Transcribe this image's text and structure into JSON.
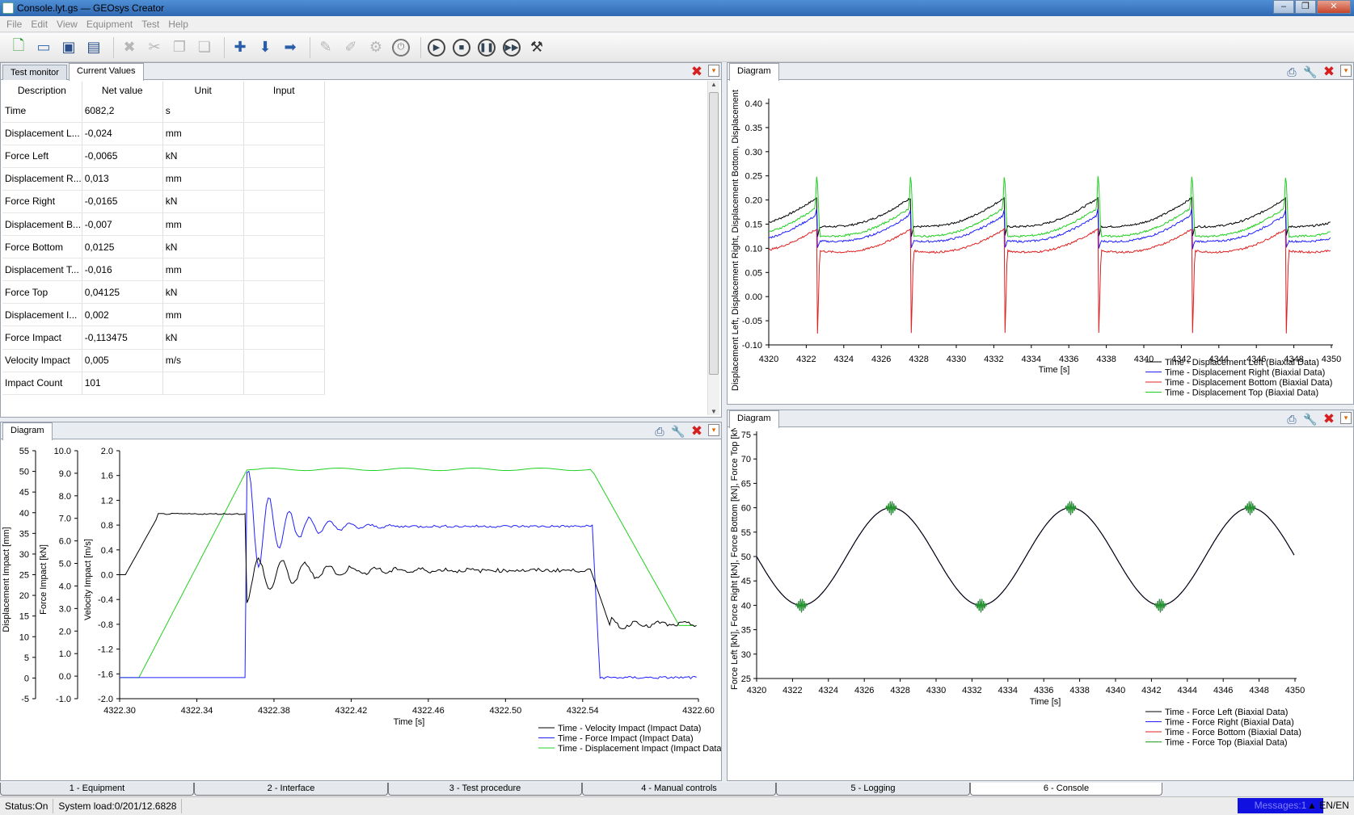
{
  "window": {
    "title": "Console.lyt.gs — GEOsys Creator",
    "min": "‒",
    "max": "❐",
    "close": "✕"
  },
  "menu": [
    "File",
    "Edit",
    "View",
    "Equipment",
    "Test",
    "Help"
  ],
  "left_panel": {
    "tabs": [
      "Test monitor",
      "Current Values"
    ],
    "columns": [
      "Description",
      "Net value",
      "Unit",
      "Input"
    ],
    "rows": [
      {
        "desc": "Time",
        "value": "6082,2",
        "unit": "s"
      },
      {
        "desc": "Displacement L...",
        "value": "-0,024",
        "unit": "mm"
      },
      {
        "desc": "Force Left",
        "value": "-0,0065",
        "unit": "kN"
      },
      {
        "desc": "Displacement R...",
        "value": "0,013",
        "unit": "mm"
      },
      {
        "desc": "Force Right",
        "value": "-0,0165",
        "unit": "kN"
      },
      {
        "desc": "Displacement B...",
        "value": "-0,007",
        "unit": "mm"
      },
      {
        "desc": "Force Bottom",
        "value": "0,0125",
        "unit": "kN"
      },
      {
        "desc": "Displacement T...",
        "value": "-0,016",
        "unit": "mm"
      },
      {
        "desc": "Force Top",
        "value": "0,04125",
        "unit": "kN"
      },
      {
        "desc": "Displacement I...",
        "value": "0,002",
        "unit": "mm"
      },
      {
        "desc": "Force Impact",
        "value": "-0,113475",
        "unit": "kN"
      },
      {
        "desc": "Velocity Impact",
        "value": "0,005",
        "unit": "m/s"
      },
      {
        "desc": "Impact Count",
        "value": "101",
        "unit": ""
      }
    ]
  },
  "diagram_tab": "Diagram",
  "bottom_tabs": [
    "1 - Equipment",
    "2 - Interface",
    "3 - Test procedure",
    "4 - Manual controls",
    "5 - Logging",
    "6 - Console"
  ],
  "status": {
    "status": "Status:On",
    "load": "System load:0/201/12.6828",
    "messages": "Messages:1",
    "lang": "EN/EN"
  },
  "chart_data": [
    {
      "type": "line",
      "name": "top-right",
      "x_label": "Time [s]",
      "y_label": "Displacement Left, Displacement Right, Displacement Bottom, Displacement",
      "xlim": [
        4320,
        4350
      ],
      "ylim": [
        -0.1,
        0.4
      ],
      "x_ticks": [
        "4320",
        "4322",
        "4324",
        "4326",
        "4328",
        "4330",
        "4332",
        "4334",
        "4336",
        "4338",
        "4340",
        "4342",
        "4344",
        "4346",
        "4348",
        "4350"
      ],
      "y_ticks": [
        "-0.10",
        "-0.05",
        "0.00",
        "0.05",
        "0.10",
        "0.15",
        "0.20",
        "0.25",
        "0.30",
        "0.35",
        "0.40"
      ],
      "impact_times": [
        4322.6,
        4327.6,
        4332.6,
        4337.6,
        4342.6,
        4347.6
      ],
      "series": [
        {
          "name": "Time - Displacement Left (Biaxial Data)",
          "color": "#000000",
          "base": 0.145,
          "amp": 0.06,
          "spike_up": 0.0,
          "spike_down": 0.02
        },
        {
          "name": "Time - Displacement Right (Biaxial Data)",
          "color": "#2020ff",
          "base": 0.115,
          "amp": 0.055,
          "spike_up": 0.02,
          "spike_down": 0.035
        },
        {
          "name": "Time - Displacement Bottom (Biaxial Data)",
          "color": "#e02020",
          "base": 0.095,
          "amp": 0.045,
          "spike_up": 0.0,
          "spike_down": 0.17
        },
        {
          "name": "Time - Displacement Top (Biaxial Data)",
          "color": "#20d020",
          "base": 0.125,
          "amp": 0.06,
          "spike_up": 0.11,
          "spike_down": 0.0
        }
      ]
    },
    {
      "type": "line",
      "name": "bottom-left",
      "x_label": "Time [s]",
      "y_labels": [
        "Displacement Impact [mm]",
        "Force Impact [kN]",
        "Velocity Impact [m/s]"
      ],
      "xlim": [
        4322.3,
        4322.6
      ],
      "x_ticks": [
        "4322.30",
        "4322.34",
        "4322.38",
        "4322.42",
        "4322.46",
        "4322.50",
        "4322.54",
        "4322.60"
      ],
      "y1_ticks": [
        "-5",
        "0",
        "5",
        "10",
        "15",
        "20",
        "25",
        "30",
        "35",
        "40",
        "45",
        "50",
        "55"
      ],
      "y2_ticks": [
        "-1.0",
        "0.0",
        "1.0",
        "2.0",
        "3.0",
        "4.0",
        "5.0",
        "6.0",
        "7.0",
        "8.0",
        "9.0",
        "10.0"
      ],
      "y3_ticks": [
        "-2.0",
        "-1.6",
        "-1.2",
        "-0.8",
        "-0.4",
        "0.0",
        "0.4",
        "0.8",
        "1.2",
        "1.6",
        "2.0"
      ],
      "ylim_velocity": [
        -2.0,
        2.0
      ],
      "series": [
        {
          "name": "Time - Velocity Impact (Impact Data)",
          "color": "#000000"
        },
        {
          "name": "Time - Force Impact (Impact Data)",
          "color": "#2020ff"
        },
        {
          "name": "Time - Displacement Impact (Impact Data)",
          "color": "#20d020"
        }
      ]
    },
    {
      "type": "line",
      "name": "bottom-right",
      "x_label": "Time [s]",
      "y_label": "Force Left [kN], Force Right [kN], Force Bottom [kN], Force Top [kN]",
      "xlim": [
        4320,
        4350
      ],
      "ylim": [
        25,
        75
      ],
      "x_ticks": [
        "4320",
        "4322",
        "4324",
        "4326",
        "4328",
        "4330",
        "4332",
        "4334",
        "4336",
        "4338",
        "4340",
        "4342",
        "4344",
        "4346",
        "4348",
        "4350"
      ],
      "y_ticks": [
        "25",
        "30",
        "35",
        "40",
        "45",
        "50",
        "55",
        "60",
        "65",
        "70",
        "75"
      ],
      "mean": 50,
      "amplitude": 10,
      "period": 10,
      "peak_time": 4327.5,
      "series": [
        {
          "name": "Time - Force Left (Biaxial Data)",
          "color": "#000000"
        },
        {
          "name": "Time - Force Right (Biaxial Data)",
          "color": "#2020ff"
        },
        {
          "name": "Time - Force Bottom (Biaxial Data)",
          "color": "#e02020"
        },
        {
          "name": "Time - Force Top (Biaxial Data)",
          "color": "#20a020"
        }
      ]
    }
  ]
}
